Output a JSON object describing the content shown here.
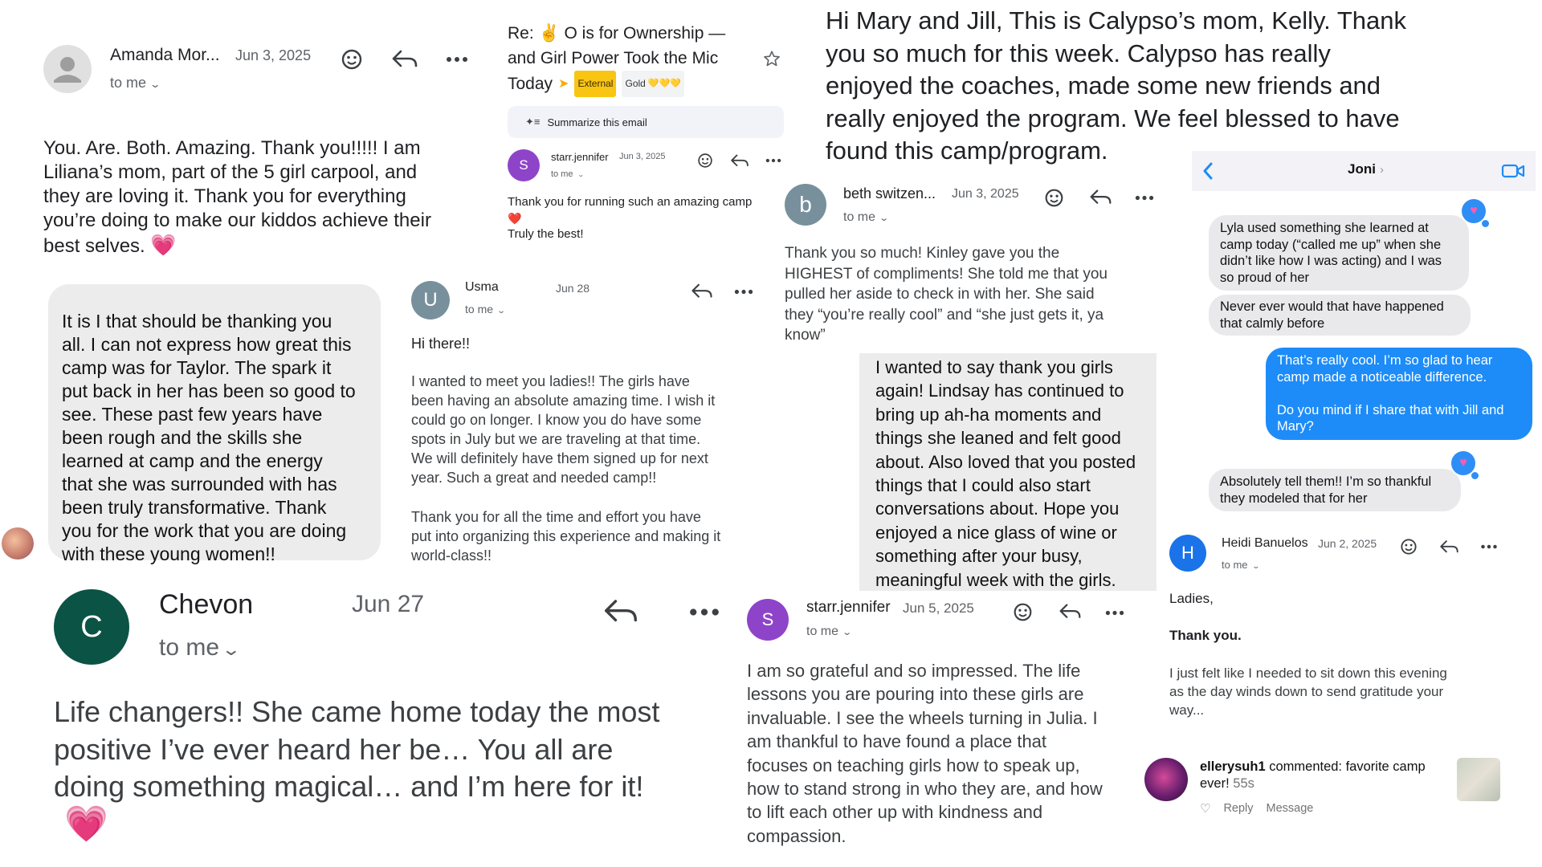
{
  "amanda": {
    "sender": "Amanda Mor...",
    "date": "Jun 3, 2025",
    "to_me": "to me",
    "body": "You. Are. Both. Amazing. Thank you!!!!! I am\nLiliana’s mom, part of the 5 girl carpool, and\nthey are loving it. Thank you for everything\nyou’re doing to make our kiddos achieve their\nbest selves.",
    "emoji": "💗"
  },
  "thread": {
    "subject_line1": "Re: ✌️ O is for Ownership —",
    "subject_line2": "and Girl Power Took the Mic",
    "subject_line3": "Today",
    "external_label": "External",
    "gold_label": "Gold",
    "gold_hearts": "💛💛💛",
    "summarize_label": "Summarize this email",
    "avatar_letter": "S",
    "sender": "starr.jennifer",
    "date": "Jun 3, 2025",
    "to_me": "to me",
    "body_line1": "Thank you for running such an amazing camp",
    "heart": "❤️",
    "body_line2": "Truly the best!"
  },
  "kelly": {
    "body": "Hi Mary and Jill, This is Calypso’s mom, Kelly. Thank\nyou so much for this week. Calypso has really\nenjoyed the coaches, made some new friends and\nreally enjoyed the program. We feel blessed to have\nfound this camp/program."
  },
  "taylor": {
    "body": "It is I that should be thanking you\nall. I can not express how great this\ncamp was for Taylor. The spark it\nput back in her has been so good to\nsee. These past few years have\nbeen rough and the skills she\nlearned at camp and the energy\nthat she was surrounded with has\nbeen truly transformative. Thank\nyou for the work that you are doing\nwith these young women!!"
  },
  "usma": {
    "avatar_letter": "U",
    "sender": "Usma",
    "date": "Jun 28",
    "to_me": "to me",
    "greeting": "Hi there!!",
    "paragraph1": "I wanted to meet you ladies!! The girls have\nbeen having an absolute amazing time. I wish it\ncould go on longer. I know you do have some\nspots in July but we are traveling at that time.\nWe will definitely have them signed up for next\nyear. Such a great and needed camp!!",
    "paragraph2": "Thank you for all the time and effort you have\nput into organizing this experience and making it\nworld-class!!"
  },
  "beth": {
    "avatar_letter": "b",
    "sender": "beth switzen...",
    "date": "Jun 3, 2025",
    "to_me": "to me",
    "body": "Thank you so much! Kinley gave you the\nHIGHEST of compliments! She told me that you\npulled her aside to check in with her. She said\nthey “you’re really cool” and “she just gets it, ya\nknow”"
  },
  "lindsay": {
    "body": "I wanted to say thank you girls\nagain! Lindsay has continued to\nbring up ah-ha moments and\nthings she leaned and felt good\nabout. Also loved that you posted\nthings that I could also start\nconversations about. Hope you\nenjoyed a nice glass of wine or\nsomething after your busy,\nmeaningful week with the girls."
  },
  "imessage": {
    "contact": "Joni",
    "messages": [
      "Lyla used something she learned at\ncamp today (“called me up” when she\ndidn’t like how I was acting) and I was\nso proud of her",
      "Never ever would that have happened\nthat calmly before",
      "That’s really cool. I’m so glad to hear\ncamp made a noticeable difference.\n\nDo you mind if I share that with Jill and\nMary?",
      "Absolutely tell them!! I’m so thankful\nthey modeled that for her"
    ],
    "tapback": "♥",
    "colors": {
      "blue_bubble": "#1d8cf8",
      "grey_bubble": "#e9e9eb"
    }
  },
  "chevon": {
    "avatar_letter": "C",
    "sender": "Chevon",
    "date": "Jun 27",
    "to_me": "to me",
    "body": "Life changers!!  She came home today the most\npositive I’ve ever heard her be… You all are\ndoing something magical… and I’m here for it!",
    "emoji": "💗",
    "colors": {
      "avatar": "#0b5345"
    }
  },
  "julia": {
    "avatar_letter": "S",
    "sender": "starr.jennifer",
    "date": "Jun 5, 2025",
    "to_me": "to me",
    "body": "I am so grateful and so impressed. The life\nlessons you are pouring into these girls are\ninvaluable. I see the wheels turning in Julia.  I\nam thankful to have found a place that\nfocuses on teaching girls how to speak up,\nhow to stand strong in who they are, and how\nto lift each other up with kindness and\ncompassion."
  },
  "heidi": {
    "avatar_letter": "H",
    "sender": "Heidi Banuelos",
    "date": "Jun 2, 2025",
    "to_me": "to me",
    "greeting": "Ladies,",
    "thanks": "Thank you.",
    "body": "I just felt like I needed to sit down this evening\nas the day winds down to send gratitude your\nway..."
  },
  "instagram": {
    "username": "ellerysuh1",
    "comment_line1": " commented: favorite camp",
    "comment_line2": "ever!",
    "time": "55s",
    "reply_label": "Reply",
    "message_label": "Message"
  },
  "colors": {
    "gmail_purple": "#8e44c9",
    "gmail_grey_avatar": "#78909c",
    "heidi_blue": "#1a73e8",
    "ios_blue": "#1d8cf8",
    "external_badge": "#f9c513"
  }
}
